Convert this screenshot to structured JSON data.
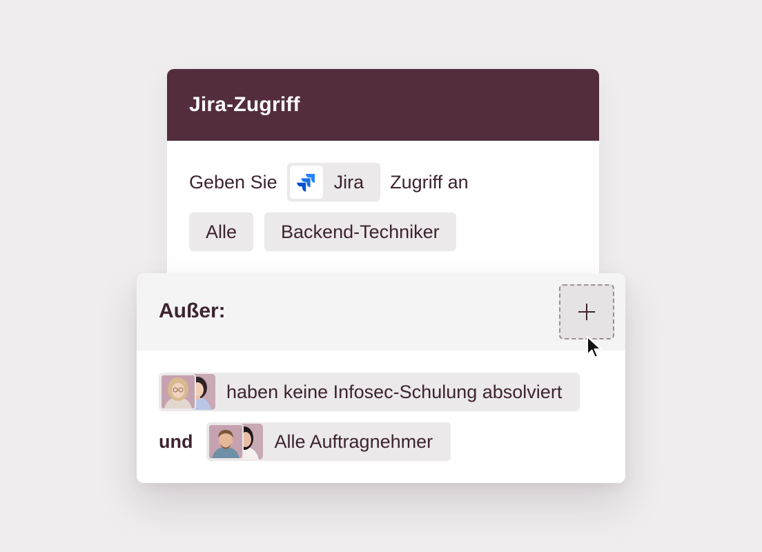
{
  "rule": {
    "title": "Jira-Zugriff",
    "sentence_prefix": "Geben Sie",
    "app": {
      "name": "Jira",
      "icon": "jira-logo-icon"
    },
    "sentence_suffix": "Zugriff an",
    "groups": [
      "Alle",
      "Backend-Techniker"
    ]
  },
  "exceptions": {
    "title": "Außer:",
    "add_icon": "plus-icon",
    "items": [
      {
        "connector": "",
        "label": "haben keine Infosec-Schulung absolviert"
      },
      {
        "connector": "und",
        "label": "Alle Auftragnehmer"
      }
    ]
  },
  "colors": {
    "header": "#532d3d",
    "text": "#3d2330",
    "chip": "#ebe9ea",
    "background": "#efedee",
    "jira_blue": "#2684ff"
  }
}
